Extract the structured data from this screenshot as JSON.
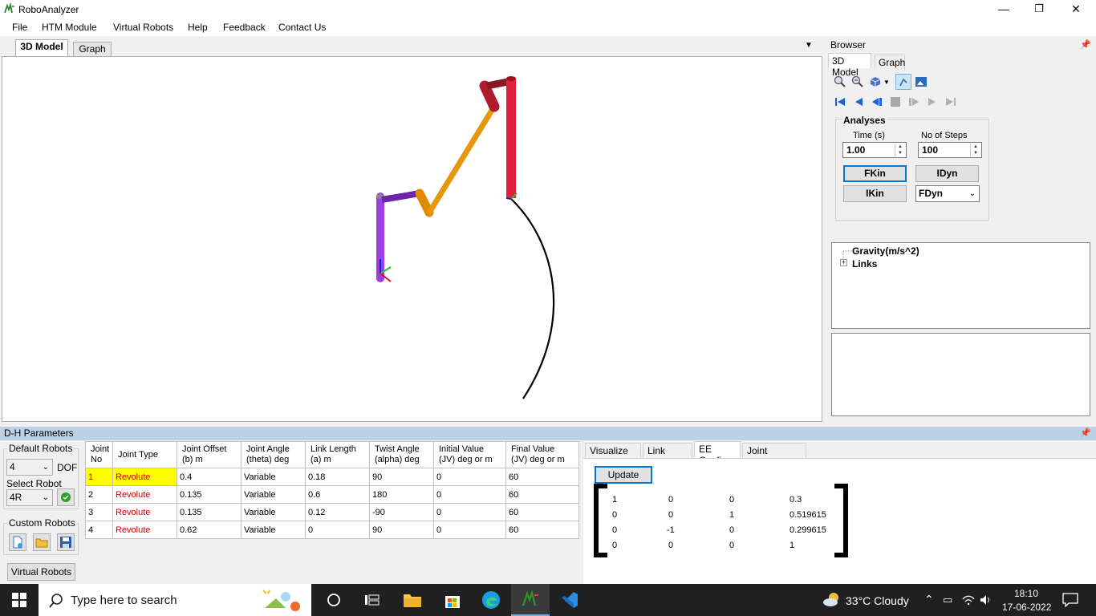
{
  "window": {
    "title": "RoboAnalyzer",
    "min": "—",
    "max": "❐",
    "close": "✕"
  },
  "menu": [
    "File",
    "HTM Module",
    "Virtual Robots",
    "Help",
    "Feedback",
    "Contact Us"
  ],
  "viewer_tabs": [
    "3D Model",
    "Graph"
  ],
  "browser": {
    "header": "Browser",
    "tabs": [
      "3D Model",
      "Graph"
    ],
    "analyses": {
      "legend": "Analyses",
      "time_label": "Time (s)",
      "time_value": "1.00",
      "steps_label": "No of Steps",
      "steps_value": "100",
      "buttons": [
        "FKin",
        "IDyn",
        "IKin"
      ],
      "fdyn_value": "FDyn"
    },
    "tree": [
      "Gravity(m/s^2)",
      "Links"
    ],
    "tree_expander": "+"
  },
  "dh": {
    "header": "D-H Parameters",
    "default_robots_label": "Default Robots",
    "dof_value": "4",
    "dof_label": "DOF",
    "select_robot_label": "Select Robot",
    "robot_value": "4R",
    "custom_robots_label": "Custom Robots",
    "virtual_robots_button": "Virtual Robots",
    "columns": [
      [
        "Joint",
        "No"
      ],
      [
        "Joint Type",
        ""
      ],
      [
        "Joint Offset",
        "(b)  m"
      ],
      [
        "Joint Angle",
        "(theta)  deg"
      ],
      [
        "Link Length",
        "(a)  m"
      ],
      [
        "Twist Angle",
        "(alpha)  deg"
      ],
      [
        "Initial Value",
        "(JV)   deg or m"
      ],
      [
        "Final Value",
        "(JV)   deg or m"
      ]
    ],
    "rows": [
      [
        "1",
        "Revolute",
        "0.4",
        "Variable",
        "0.18",
        "90",
        "0",
        "60"
      ],
      [
        "2",
        "Revolute",
        "0.135",
        "Variable",
        "0.6",
        "180",
        "0",
        "60"
      ],
      [
        "3",
        "Revolute",
        "0.135",
        "Variable",
        "0.12",
        "-90",
        "0",
        "60"
      ],
      [
        "4",
        "Revolute",
        "0.62",
        "Variable",
        "0",
        "90",
        "0",
        "60"
      ]
    ]
  },
  "ee": {
    "tabs": [
      "Visualize DH",
      "Link Config",
      "EE Config",
      "Joint Trajectory"
    ],
    "update_button": "Update",
    "matrix": [
      [
        "1",
        "0",
        "0",
        "0.3"
      ],
      [
        "0",
        "0",
        "1",
        "0.519615"
      ],
      [
        "0",
        "-1",
        "0",
        "0.299615"
      ],
      [
        "0",
        "0",
        "0",
        "1"
      ]
    ]
  },
  "taskbar": {
    "search_placeholder": "Type here to search",
    "weather": "33°C  Cloudy",
    "time": "18:10",
    "date": "17-06-2022"
  },
  "colors": {
    "dh_header": "#bcd0e6",
    "highlight": "#ffff00",
    "accent": "#0078d7"
  }
}
